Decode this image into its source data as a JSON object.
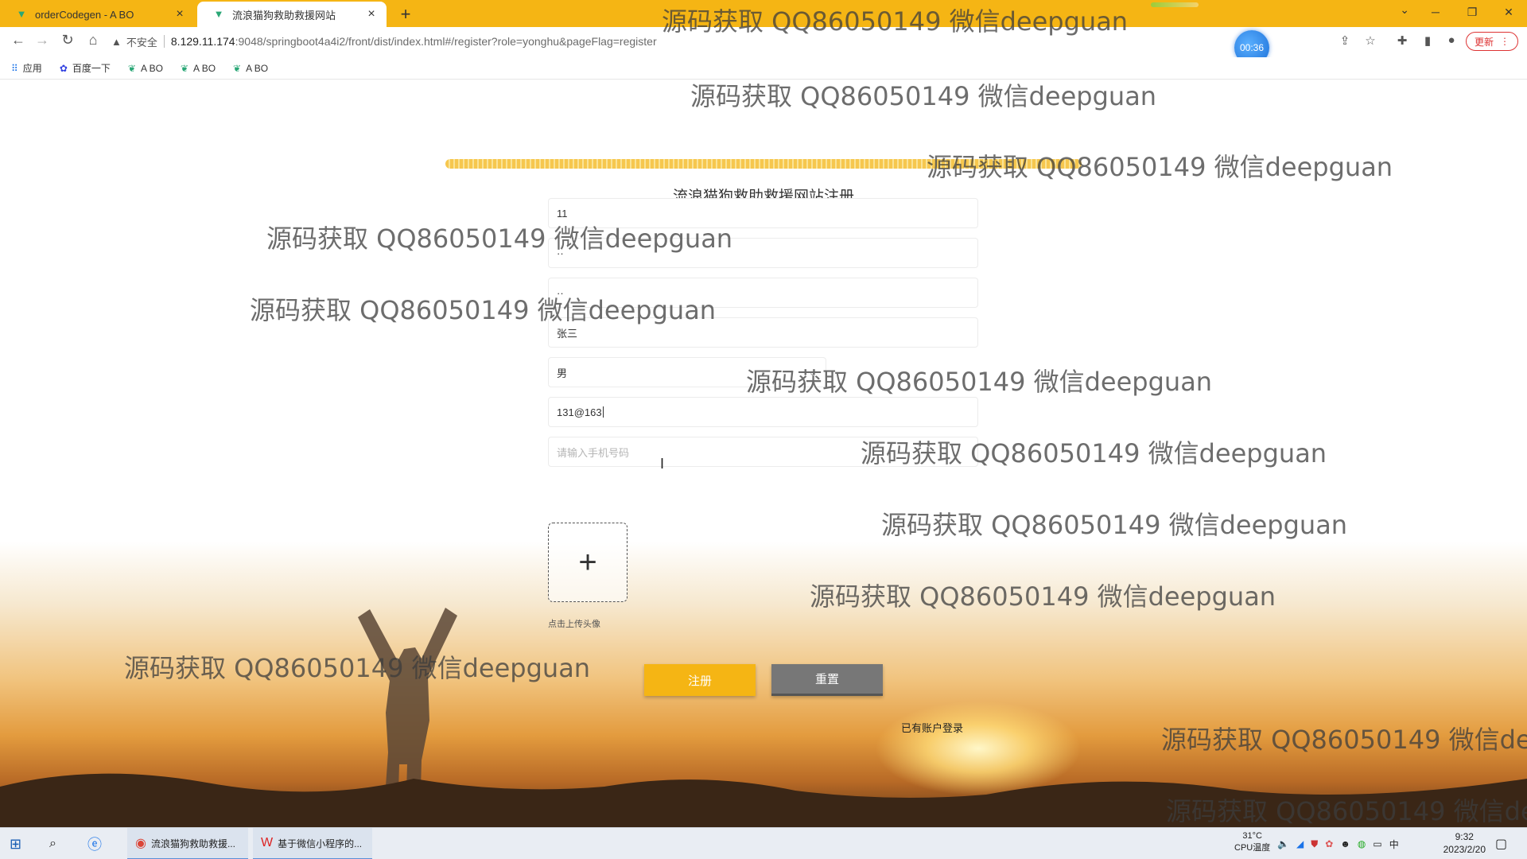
{
  "browser": {
    "tabs": [
      {
        "title": "orderCodegen - A BO",
        "active": false
      },
      {
        "title": "流浪猫狗救助救援网站",
        "active": true
      }
    ],
    "new_tab": "+",
    "window_controls": {
      "min": "─",
      "max": "❐",
      "close": "✕"
    },
    "address": {
      "security_label": "不安全",
      "host": "8.129.11.174",
      "path": ":9048/springboot4a4i2/front/dist/index.html#/register?role=yonghu&pageFlag=register"
    },
    "timer": "00:36",
    "update_label": "更新",
    "bookmarks": [
      {
        "label": "应用",
        "icon": "apps-grid-icon"
      },
      {
        "label": "百度一下",
        "icon": "baidu-paw-icon"
      },
      {
        "label": "A BO",
        "icon": "leaf-icon"
      },
      {
        "label": "A BO",
        "icon": "leaf-icon"
      },
      {
        "label": "A BO",
        "icon": "leaf-icon"
      }
    ]
  },
  "register": {
    "title": "流浪猫狗救助救援网站注册",
    "fields": {
      "account": "11",
      "password": "··",
      "confirm_password": "··",
      "name": "张三",
      "gender": "男",
      "email": "131@163",
      "phone_placeholder": "请输入手机号码"
    },
    "upload_plus": "+",
    "upload_label": "点击上传头像",
    "register_button": "注册",
    "reset_button": "重置",
    "login_link": "已有账户登录"
  },
  "watermark": "源码获取 QQ86050149 微信deepguan",
  "taskbar": {
    "apps": [
      {
        "label": "流浪猫狗救助救援..."
      },
      {
        "label": "基于微信小程序的..."
      }
    ],
    "temperature": "31°C",
    "cpu_label": "CPU温度",
    "ime": "中",
    "time": "9:32",
    "date": "2023/2/20"
  },
  "colors": {
    "accent": "#f5b514",
    "reset": "#777777"
  }
}
